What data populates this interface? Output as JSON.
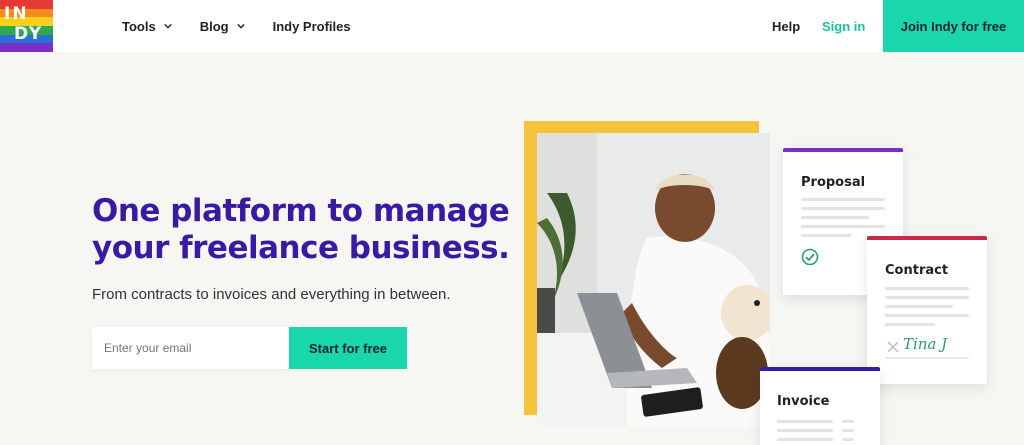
{
  "header": {
    "logo_text": [
      "IN",
      "DY"
    ],
    "nav": [
      {
        "label": "Tools",
        "has_dropdown": true
      },
      {
        "label": "Blog",
        "has_dropdown": true
      },
      {
        "label": "Indy Profiles",
        "has_dropdown": false
      }
    ],
    "help_label": "Help",
    "signin_label": "Sign in",
    "join_label": "Join Indy for free"
  },
  "hero": {
    "headline_line1": "One platform to manage",
    "headline_line2": "your freelance business.",
    "subline": "From contracts to invoices and everything in between.",
    "email_placeholder": "Enter your email",
    "cta_label": "Start for free"
  },
  "cards": {
    "proposal_title": "Proposal",
    "contract_title": "Contract",
    "contract_signature": "Tina J",
    "invoice_title": "Invoice"
  },
  "colors": {
    "brand_purple": "#3b1aa3",
    "accent_teal": "#19d6ac",
    "signin_green": "#19c49a",
    "photo_frame_yellow": "#f5c23c",
    "proposal_bar": "#7b2fc9",
    "contract_bar": "#c9284b",
    "invoice_bar": "#3b1aa3",
    "page_bg": "#f6f6f2"
  },
  "icons": [
    "chevron-down-icon",
    "check-circle-icon",
    "x-mark-icon",
    "rainbow-logo"
  ]
}
